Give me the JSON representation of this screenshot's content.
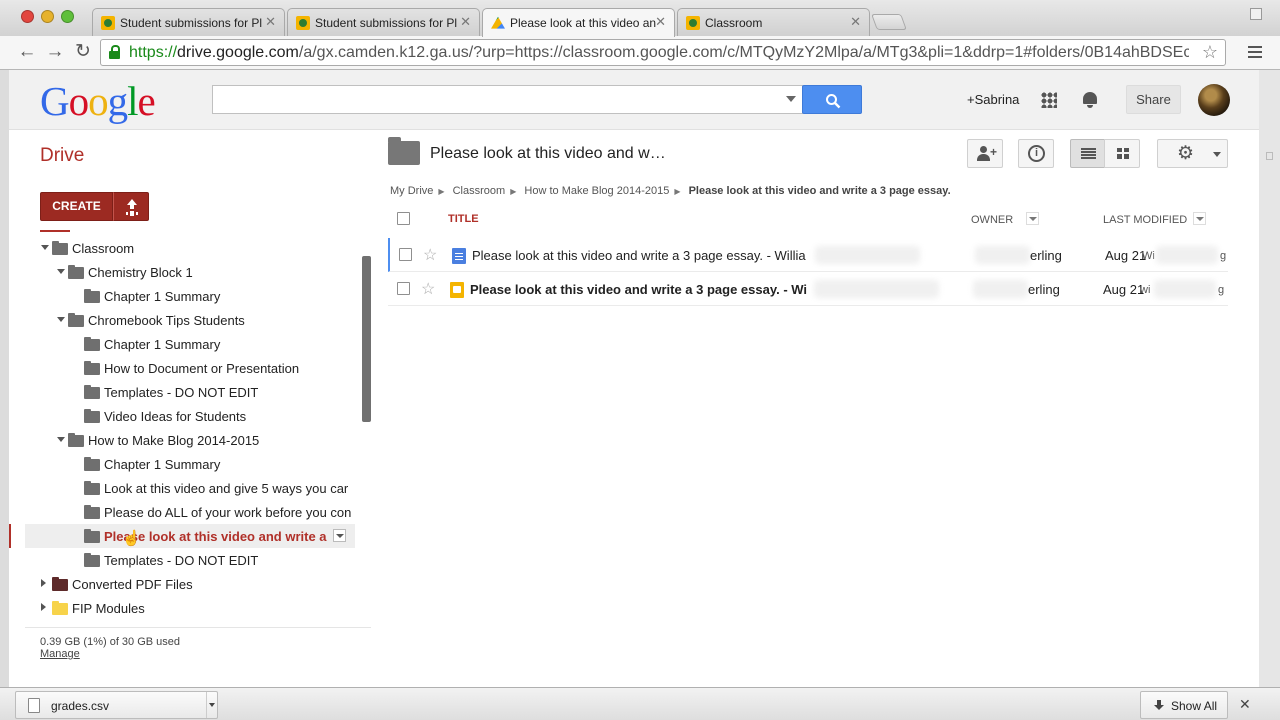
{
  "browser": {
    "tabs": [
      {
        "title": "Student submissions for Pl",
        "icon": "classroom-icon",
        "active": false
      },
      {
        "title": "Student submissions for Pl",
        "icon": "classroom-icon",
        "active": false
      },
      {
        "title": "Please look at this video an",
        "icon": "drive-icon",
        "active": true
      },
      {
        "title": "Classroom",
        "icon": "classroom-icon",
        "active": false
      }
    ],
    "tab_close_glyph": "✕",
    "url_scheme": "https://",
    "url_host": "drive.google.com",
    "url_rest": "/a/gx.camden.k12.ga.us/?urp=https://classroom.google.com/c/MTQyMzY2Mlpa/a/MTg3&pli=1&ddrp=1#folders/0B14ahBDSEc...",
    "back_glyph": "←",
    "forward_glyph": "→",
    "reload_glyph": "↻",
    "bookmark_glyph": "☆"
  },
  "header": {
    "logo": "Google",
    "logo_colors": [
      "#3369e8",
      "#d50f25",
      "#eeb211",
      "#3369e8",
      "#009925",
      "#d50f25"
    ],
    "user_link": "+Sabrina",
    "share_label": "Share",
    "search_button_color": "#4d8ef0"
  },
  "drive": {
    "title": "Drive",
    "folder_title": "Please look at this video and w…",
    "create_label": "CREATE",
    "accent_color": "#b03029"
  },
  "sidebar": {
    "tree": [
      {
        "label": "Classroom",
        "depth": 1,
        "arrow": "down",
        "folder": "gray"
      },
      {
        "label": "Chemistry Block 1",
        "depth": 2,
        "arrow": "down",
        "folder": "gray"
      },
      {
        "label": "Chapter 1 Summary",
        "depth": 3,
        "arrow": "",
        "folder": "gray"
      },
      {
        "label": "Chromebook Tips Students",
        "depth": 2,
        "arrow": "down",
        "folder": "gray"
      },
      {
        "label": "Chapter 1 Summary",
        "depth": 3,
        "arrow": "",
        "folder": "gray"
      },
      {
        "label": "How to Document or Presentation",
        "depth": 3,
        "arrow": "",
        "folder": "gray"
      },
      {
        "label": "Templates - DO NOT EDIT",
        "depth": 3,
        "arrow": "",
        "folder": "gray"
      },
      {
        "label": "Video Ideas for Students",
        "depth": 3,
        "arrow": "",
        "folder": "gray"
      },
      {
        "label": "How to Make Blog 2014-2015",
        "depth": 2,
        "arrow": "down",
        "folder": "gray"
      },
      {
        "label": "Chapter 1 Summary",
        "depth": 3,
        "arrow": "",
        "folder": "gray"
      },
      {
        "label": "Look at this video and give 5 ways you car",
        "depth": 3,
        "arrow": "",
        "folder": "gray"
      },
      {
        "label": "Please do ALL of your work before you con",
        "depth": 3,
        "arrow": "",
        "folder": "gray"
      },
      {
        "label": "Please look at this video and write a",
        "depth": 3,
        "arrow": "",
        "folder": "gray",
        "selected": true
      },
      {
        "label": "Templates - DO NOT EDIT",
        "depth": 3,
        "arrow": "",
        "folder": "gray"
      },
      {
        "label": "Converted PDF Files",
        "depth": 1,
        "arrow": "right",
        "folder": "dark-red"
      },
      {
        "label": "FIP Modules",
        "depth": 1,
        "arrow": "right",
        "folder": "yellow"
      }
    ],
    "storage": "0.39 GB (1%) of 30 GB used",
    "manage_label": "Manage"
  },
  "main": {
    "breadcrumb": [
      "My Drive",
      "Classroom",
      "How to Make Blog 2014-2015",
      "Please look at this video and write a 3 page essay."
    ],
    "breadcrumb_sep": "▶",
    "columns": {
      "title": "TITLE",
      "owner": "OWNER",
      "modified": "LAST MODIFIED"
    },
    "rows": [
      {
        "name": "Please look at this video and write a 3 page essay. - Willia",
        "owner": "erling",
        "modified": "Aug 21",
        "modified_by": "Wi",
        "modified_by_tail": "g",
        "type": "document",
        "bold": false
      },
      {
        "name": "Please look at this video and write a 3 page essay. - Wi",
        "owner": "erling",
        "modified": "Aug 21",
        "modified_by": "wi",
        "modified_by_tail": "g",
        "type": "classroom-assignment",
        "bold": true
      }
    ],
    "star_glyph": "☆"
  },
  "download_shelf": {
    "file_name": "grades.csv",
    "show_all_label": "Show All",
    "close_glyph": "✕"
  }
}
